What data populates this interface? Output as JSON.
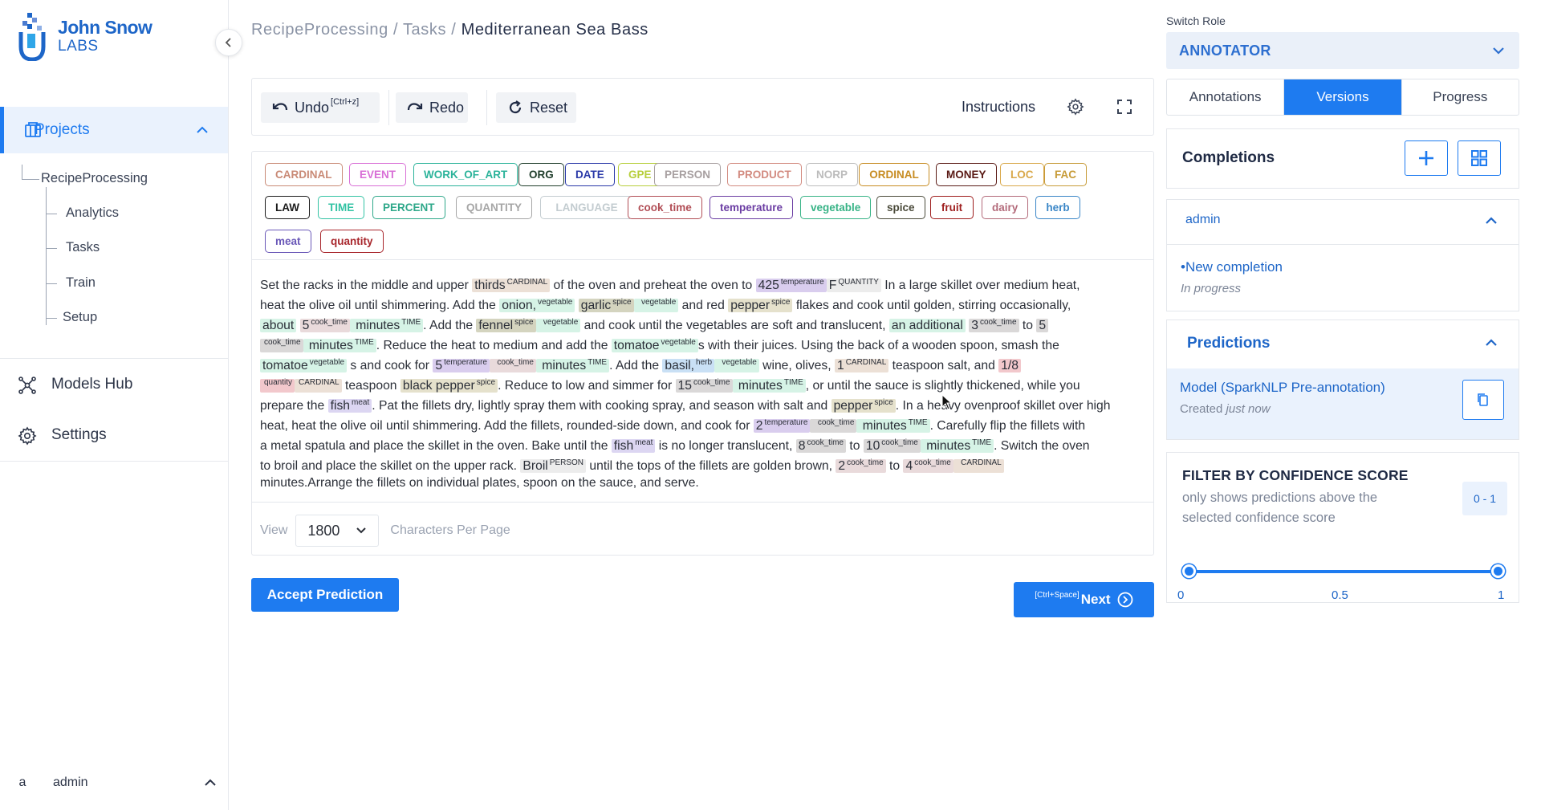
{
  "brand": {
    "line1": "John Snow",
    "line2": "LABS"
  },
  "sidebar": {
    "projects_label": "Projects",
    "project_name": "RecipeProcessing",
    "subitems": [
      "Analytics",
      "Tasks",
      "Train",
      "Setup"
    ],
    "models_hub_label": "Models Hub",
    "settings_label": "Settings",
    "user_initial": "a",
    "user_name": "admin"
  },
  "breadcrumb": {
    "project": "RecipeProcessing",
    "section": "Tasks",
    "current": "Mediterranean Sea Bass",
    "sep": "/"
  },
  "toolbar": {
    "undo_label": "Undo",
    "undo_shortcut": "[Ctrl+z]",
    "redo_label": "Redo",
    "reset_label": "Reset",
    "instructions_label": "Instructions"
  },
  "tags": [
    {
      "text": "CARDINAL",
      "color": "#c98a76"
    },
    {
      "text": "EVENT",
      "color": "#d86fd6"
    },
    {
      "text": "WORK_OF_ART",
      "color": "#2bb39a"
    },
    {
      "text": "ORG",
      "color": "#1f3d2b"
    },
    {
      "text": "DATE",
      "color": "#2a39a8"
    },
    {
      "text": "GPE",
      "color": "#b7cf3c"
    },
    {
      "text": "PERSON",
      "color": "#a79fa0"
    },
    {
      "text": "PRODUCT",
      "color": "#d28a7f"
    },
    {
      "text": "NORP",
      "color": "#bcbcbc"
    },
    {
      "text": "ORDINAL",
      "color": "#c78c22"
    },
    {
      "text": "MONEY",
      "color": "#5a1a15"
    },
    {
      "text": "LOC",
      "color": "#d9a84a"
    },
    {
      "text": "FAC",
      "color": "#c79b38"
    },
    {
      "text": "LAW",
      "color": "#1b1b1b"
    },
    {
      "text": "TIME",
      "color": "#33c3a4"
    },
    {
      "text": "PERCENT",
      "color": "#2fa88a"
    },
    {
      "text": "QUANTITY",
      "color": "#a6a6a6"
    },
    {
      "text": "LANGUAGE",
      "color": "#c3ccd0"
    },
    {
      "text": "cook_time",
      "color": "#b14d55"
    },
    {
      "text": "temperature",
      "color": "#6b3da3"
    },
    {
      "text": "vegetable",
      "color": "#37b386"
    },
    {
      "text": "spice",
      "color": "#4a4a3a"
    },
    {
      "text": "fruit",
      "color": "#9e1d1d"
    },
    {
      "text": "dairy",
      "color": "#b36a7a"
    },
    {
      "text": "herb",
      "color": "#3a86c7"
    },
    {
      "text": "meat",
      "color": "#6a58b8"
    },
    {
      "text": "quantity",
      "color": "#a8262c"
    }
  ],
  "document_lines": [
    [
      [
        "Set the racks in the middle and upper "
      ],
      [
        "thirds",
        "CARDINAL",
        "#ece0d6"
      ],
      [
        " of the oven and preheat the oven to "
      ],
      [
        "425",
        "temperature",
        "#d9cdee"
      ],
      [
        "F",
        "QUANTITY",
        "#ececec"
      ],
      [
        " In a large skillet over medium heat,"
      ]
    ],
    [
      [
        "heat the olive oil until shimmering. Add the "
      ],
      [
        "onion,",
        "vegetable",
        "#d6f3e6"
      ],
      [
        " "
      ],
      [
        "garlic",
        "spice",
        "#d4d4bf"
      ],
      [
        " ",
        "vegetable",
        "#d6f3e6"
      ],
      [
        " and red "
      ],
      [
        "pepper",
        "spice",
        "#e5e1cc"
      ],
      [
        " flakes and cook until golden, stirring occasionally,"
      ]
    ],
    [
      [
        "about",
        "",
        "#d6f3e6"
      ],
      [
        " "
      ],
      [
        "5",
        "cook_time",
        "#e9dadb"
      ],
      [
        " minutes",
        "TIME",
        "#d6f3e6"
      ],
      [
        ". Add the "
      ],
      [
        "fennel",
        "spice",
        "#d4d4bf"
      ],
      [
        " ",
        "vegetable",
        "#d6f3e6"
      ],
      [
        " and cook until the vegetables are soft and translucent, "
      ],
      [
        "an additional",
        "",
        "#d6f3e6"
      ],
      [
        " "
      ],
      [
        "3",
        "cook_time",
        "#dad8d8"
      ],
      [
        " to "
      ],
      [
        "5",
        "",
        "#dad8d8"
      ]
    ],
    [
      [
        "",
        "cook_time",
        "#dad8d8"
      ],
      [
        " minutes",
        "TIME",
        "#d6f3e6"
      ],
      [
        ". Reduce the heat to medium and add the "
      ],
      [
        "tomatoe",
        "vegetable",
        "#d6f3e6"
      ],
      [
        "s with their juices. Using the back of a wooden spoon, smash the"
      ]
    ],
    [
      [
        "tomatoe",
        "vegetable",
        "#d6f3e6"
      ],
      [
        " s and cook for "
      ],
      [
        "5",
        "temperature",
        "#d9cdee"
      ],
      [
        " ",
        "cook_time",
        "#e9dadb"
      ],
      [
        " minutes",
        "TIME",
        "#d6f3e6"
      ],
      [
        ". Add the "
      ],
      [
        "basil,",
        "herb",
        "#c9e0f5"
      ],
      [
        " ",
        "vegetable",
        "#d6f3e6"
      ],
      [
        " wine, olives, "
      ],
      [
        "1",
        "CARDINAL",
        "#ece0d6"
      ],
      [
        " teaspoon salt, and "
      ],
      [
        "1/8",
        "",
        "#f2c8cc"
      ]
    ],
    [
      [
        "",
        "quantity",
        "#f2c8cc"
      ],
      [
        "",
        "CARDINAL",
        "#ece0d6"
      ],
      [
        " teaspoon "
      ],
      [
        "black pepper",
        "spice",
        "#e5e1cc"
      ],
      [
        ". Reduce to low and simmer for "
      ],
      [
        "15",
        "cook_time",
        "#dad8d8"
      ],
      [
        " minutes",
        "TIME",
        "#d6f3e6"
      ],
      [
        ", or until the sauce is slightly thickened, while you"
      ]
    ],
    [
      [
        "prepare the "
      ],
      [
        "fish",
        "meat",
        "#dcd6f2"
      ],
      [
        ". Pat the fillets dry, lightly spray them with cooking spray, and season with salt and "
      ],
      [
        "pepper",
        "spice",
        "#e5e1cc"
      ],
      [
        ". In a heavy ovenproof skillet over high"
      ]
    ],
    [
      [
        "heat, heat the olive oil until shimmering. Add the fillets, rounded-side down, and cook for "
      ],
      [
        "2",
        "temperature",
        "#d9cdee"
      ],
      [
        " ",
        "cook_time",
        "#dad8d8"
      ],
      [
        " minutes",
        "TIME",
        "#d6f3e6"
      ],
      [
        ". Carefully flip the fillets with"
      ]
    ],
    [
      [
        "a metal spatula and place the skillet in the oven. Bake until the "
      ],
      [
        "fish",
        "meat",
        "#dcd6f2"
      ],
      [
        " is no longer translucent, "
      ],
      [
        "8",
        "cook_time",
        "#dad8d8"
      ],
      [
        " to "
      ],
      [
        "10",
        "cook_time",
        "#dad8d8"
      ],
      [
        " minutes",
        "TIME",
        "#d6f3e6"
      ],
      [
        ". Switch the oven"
      ]
    ],
    [
      [
        "to broil and place the skillet on the upper rack. "
      ],
      [
        "Broil",
        "PERSON",
        "#ececec"
      ],
      [
        " until the tops of the fillets are golden brown, "
      ],
      [
        "2",
        "cook_time",
        "#e9dadb"
      ],
      [
        " to "
      ],
      [
        "4",
        "cook_time",
        "#e9dadb"
      ],
      [
        " ",
        "CARDINAL",
        "#ece0d6"
      ]
    ],
    [
      [
        "minutes.Arrange the fillets on individual plates, spoon on the sauce, and serve."
      ]
    ]
  ],
  "pagination": {
    "view_label": "View",
    "per_page_value": "1800",
    "per_page_label": "Characters Per Page"
  },
  "actions": {
    "accept_label": "Accept Prediction",
    "next_shortcut": "[Ctrl+Space]",
    "next_label": "Next"
  },
  "right": {
    "switch_role_label": "Switch Role",
    "role_value": "ANNOTATOR",
    "tabs": [
      "Annotations",
      "Versions",
      "Progress"
    ],
    "active_tab": "Versions",
    "completions_title": "Completions",
    "completion_user": "admin",
    "new_completion": "New completion",
    "completion_status": "In progress",
    "predictions_title": "Predictions",
    "prediction_model": "Model (SparkNLP Pre-annotation)",
    "prediction_created_prefix": "Created ",
    "prediction_created_when": "just now",
    "filter_title": "FILTER BY CONFIDENCE SCORE",
    "filter_desc": "only shows predictions above the selected confidence score",
    "filter_range": "0 - 1",
    "slider_min": "0",
    "slider_mid": "0.5",
    "slider_max": "1",
    "slider_low_value": 0,
    "slider_high_value": 1
  },
  "colors": {
    "accent": "#1e7bf0",
    "brand": "#1e66c8"
  }
}
